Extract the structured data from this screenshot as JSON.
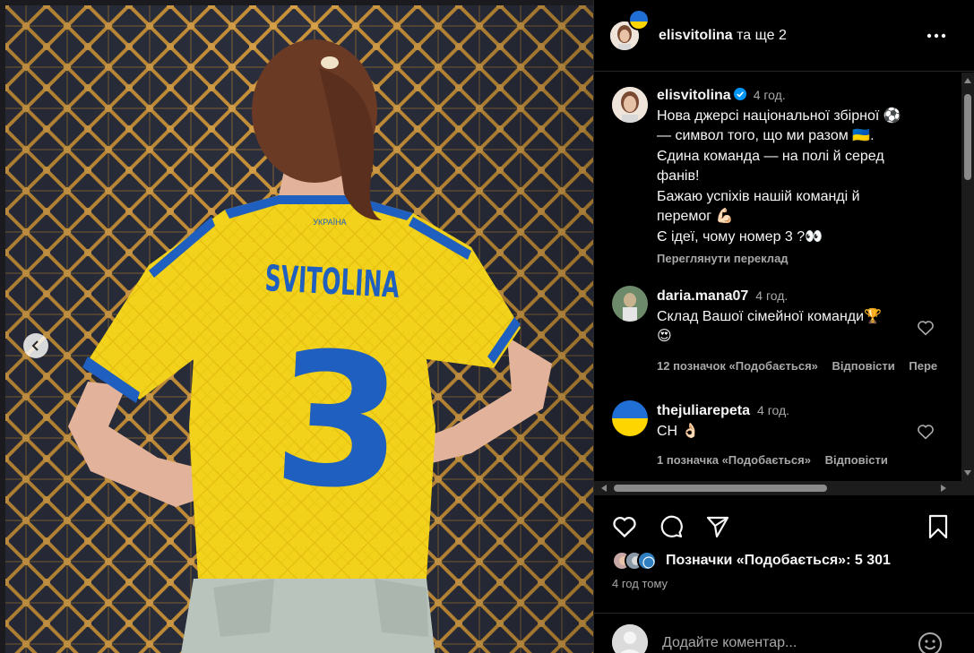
{
  "photo": {
    "jersey_name": "SVITOLINA",
    "jersey_number": "3",
    "jersey_country": "УКРАЇНА"
  },
  "header": {
    "username": "elisvitolina",
    "suffix": " та ще 2"
  },
  "caption": {
    "username": "elisvitolina",
    "time": "4 год.",
    "lines": [
      "Нова джерсі національної збірної ⚽",
      "— символ того, що ми разом 🇺🇦.",
      "Єдина команда — на полі й серед",
      "фанів!",
      "Бажаю успіхів нашій команді й",
      "перемог 💪🏻",
      "Є ідеї, чому номер 3 ?👀"
    ],
    "translate": "Переглянути переклад"
  },
  "comments": [
    {
      "username": "daria.mana07",
      "time": "4 год.",
      "lines": [
        "Склад Вашої сімейної команди🏆",
        "😍"
      ],
      "likes": "12 позначок «Подобається»",
      "reply": "Відповісти",
      "extra": "Пере"
    },
    {
      "username": "thejuliarepeta",
      "time": "4 год.",
      "lines": [
        "СН 👌🏻"
      ],
      "likes": "1 позначка «Подобається»",
      "reply": "Відповісти"
    }
  ],
  "likes": {
    "label": "Позначки «Подобається»: 5 301"
  },
  "post_time": "4 год тому",
  "add_comment": {
    "placeholder": "Додайте коментар..."
  },
  "colors": {
    "jersey_yellow": "#f2d21a",
    "jersey_blue": "#1f5fbf",
    "background": "#000000",
    "secondary_text": "#a8a8a8",
    "verified_blue": "#0095f6"
  }
}
